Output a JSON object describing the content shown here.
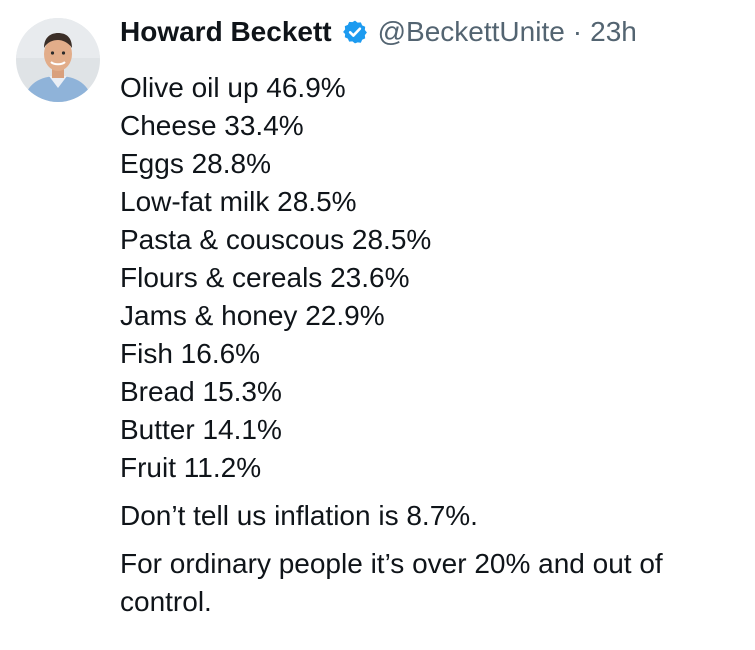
{
  "author": {
    "display_name": "Howard Beckett",
    "verified_icon": "verified-badge-icon",
    "handle": "@BeckettUnite",
    "separator": "·",
    "timestamp": "23h",
    "avatar_icon": "profile-photo"
  },
  "tweet": {
    "lines": [
      "Olive oil up 46.9%",
      "Cheese 33.4%",
      "Eggs 28.8%",
      "Low-fat milk 28.5%",
      "Pasta & couscous 28.5%",
      "Flours & cereals 23.6%",
      "Jams & honey 22.9%",
      "Fish 16.6%",
      "Bread 15.3%",
      "Butter 14.1%",
      "Fruit 11.2%"
    ],
    "paragraph_1": "Don’t tell us inflation is 8.7%.",
    "paragraph_2": "For ordinary people it’s over 20% and out of control."
  },
  "colors": {
    "text": "#0f1419",
    "secondary": "#536471",
    "verified": "#1d9bf0"
  }
}
